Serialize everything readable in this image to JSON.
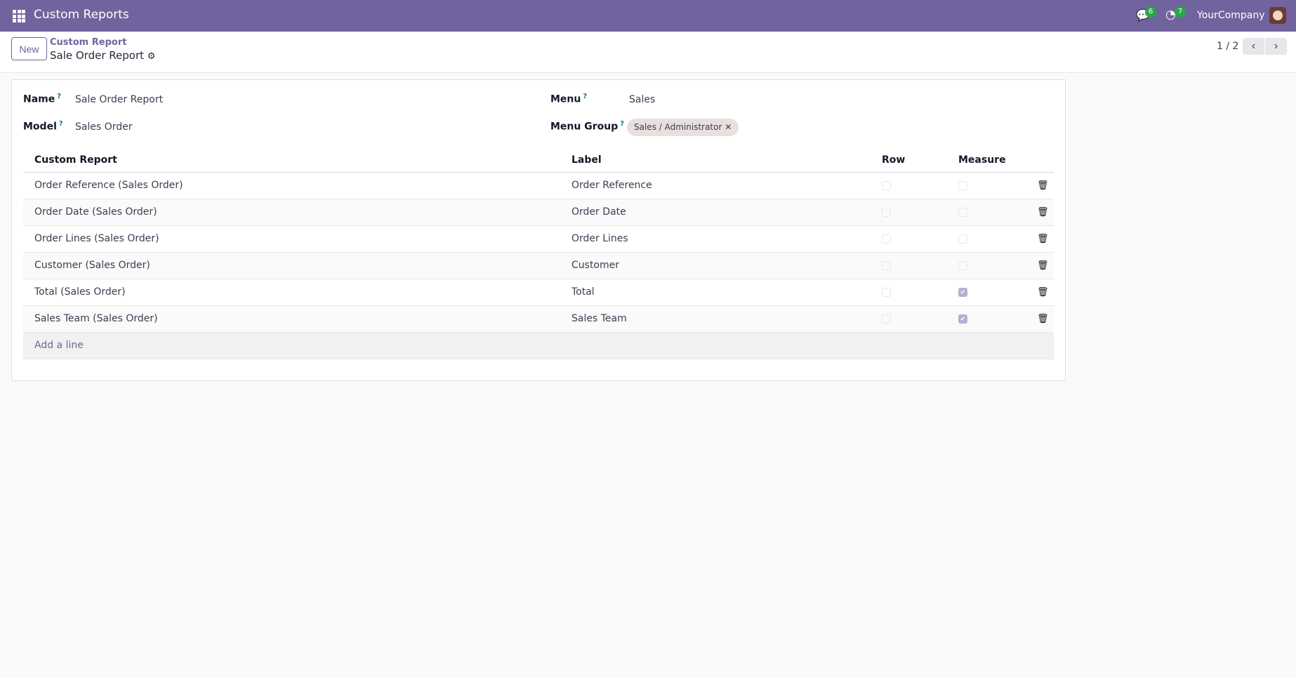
{
  "navbar": {
    "app_title": "Custom Reports",
    "messages_count": "6",
    "activities_count": "7",
    "company": "YourCompany"
  },
  "control_panel": {
    "new_label": "New",
    "breadcrumb_parent": "Custom Report",
    "breadcrumb_current": "Sale Order Report",
    "pager": "1 / 2"
  },
  "form": {
    "name_label": "Name",
    "name_value": "Sale Order Report",
    "model_label": "Model",
    "model_value": "Sales Order",
    "menu_label": "Menu",
    "menu_value": "Sales",
    "menu_group_label": "Menu Group",
    "menu_group_tag": "Sales / Administrator",
    "help_mark": "?"
  },
  "table": {
    "headers": [
      "Custom Report",
      "Label",
      "Row",
      "Measure"
    ],
    "rows": [
      {
        "field": "Order Reference (Sales Order)",
        "label": "Order Reference",
        "row": false,
        "measure": false
      },
      {
        "field": "Order Date (Sales Order)",
        "label": "Order Date",
        "row": false,
        "measure": false
      },
      {
        "field": "Order Lines (Sales Order)",
        "label": "Order Lines",
        "row": false,
        "measure": false
      },
      {
        "field": "Customer (Sales Order)",
        "label": "Customer",
        "row": false,
        "measure": false
      },
      {
        "field": "Total (Sales Order)",
        "label": "Total",
        "row": false,
        "measure": true
      },
      {
        "field": "Sales Team (Sales Order)",
        "label": "Sales Team",
        "row": false,
        "measure": true
      }
    ],
    "add_line": "Add a line"
  }
}
